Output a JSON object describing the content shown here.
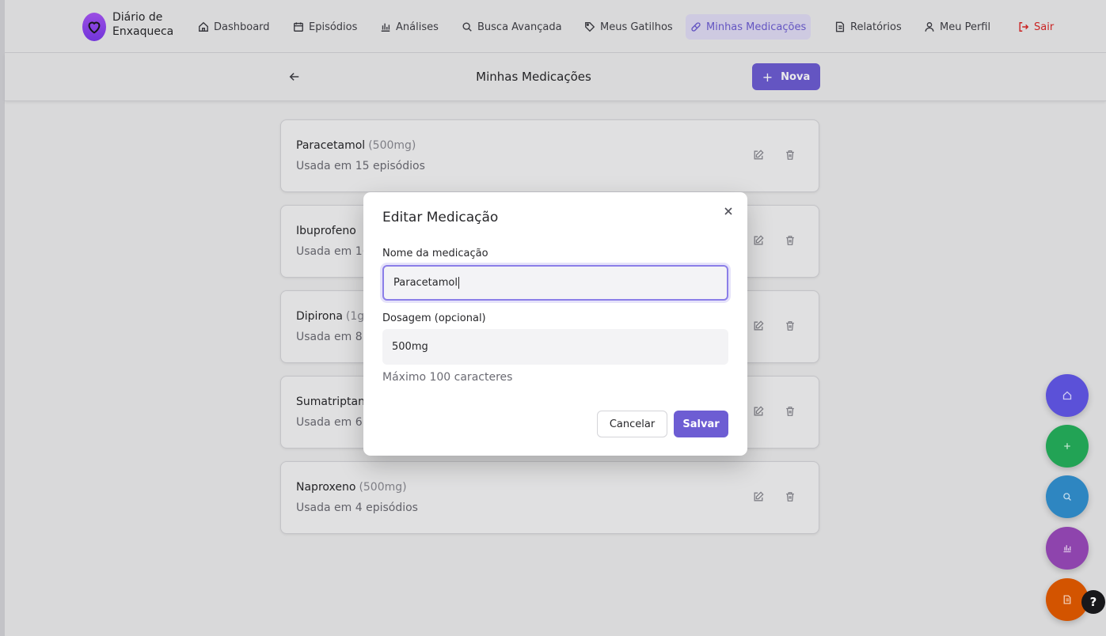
{
  "brand": {
    "line1": "Diário de",
    "line2": "Enxaqueca"
  },
  "nav": [
    {
      "label": "Dashboard"
    },
    {
      "label": "Episódios"
    },
    {
      "label": "Análises"
    },
    {
      "label": "Busca Avançada"
    },
    {
      "label": "Meus Gatilhos"
    },
    {
      "label": "Minhas Medicações"
    },
    {
      "label": "Relatórios"
    },
    {
      "label": "Meu Perfil"
    },
    {
      "label": "Sair"
    }
  ],
  "header": {
    "title": "Minhas Medicações",
    "new_label": "Nova",
    "new_plus": "+"
  },
  "medications": [
    {
      "name": "Paracetamol",
      "dose": "(500mg)",
      "usage": "Usada em 15 episódios"
    },
    {
      "name": "Ibuprofeno",
      "dose": "",
      "usage": "Usada em 1("
    },
    {
      "name": "Dipirona",
      "dose": "(1g",
      "usage": "Usada em 8"
    },
    {
      "name": "Sumatriptan",
      "dose": "",
      "usage": "Usada em 6"
    },
    {
      "name": "Naproxeno",
      "dose": "(500mg)",
      "usage": "Usada em 4 episódios"
    }
  ],
  "modal": {
    "title": "Editar Medicação",
    "name_label": "Nome da medicação",
    "name_value": "Paracetamol",
    "dose_label": "Dosagem (opcional)",
    "dose_value": "500mg",
    "hint": "Máximo 100 caracteres",
    "cancel": "Cancelar",
    "save": "Salvar"
  },
  "fabs": [
    {
      "icon": "home-icon",
      "color": "#5b51d8"
    },
    {
      "icon": "plus-icon",
      "color": "#22a355"
    },
    {
      "icon": "search-icon",
      "color": "#2e86c1"
    },
    {
      "icon": "chart-icon",
      "color": "#8e44ad"
    },
    {
      "icon": "document-icon",
      "color": "#d35400"
    }
  ],
  "help_label": "?",
  "colors": {
    "accent": "#6d5dd3",
    "active_nav_bg": "#e0dcf5",
    "logout": "#dc2626"
  }
}
